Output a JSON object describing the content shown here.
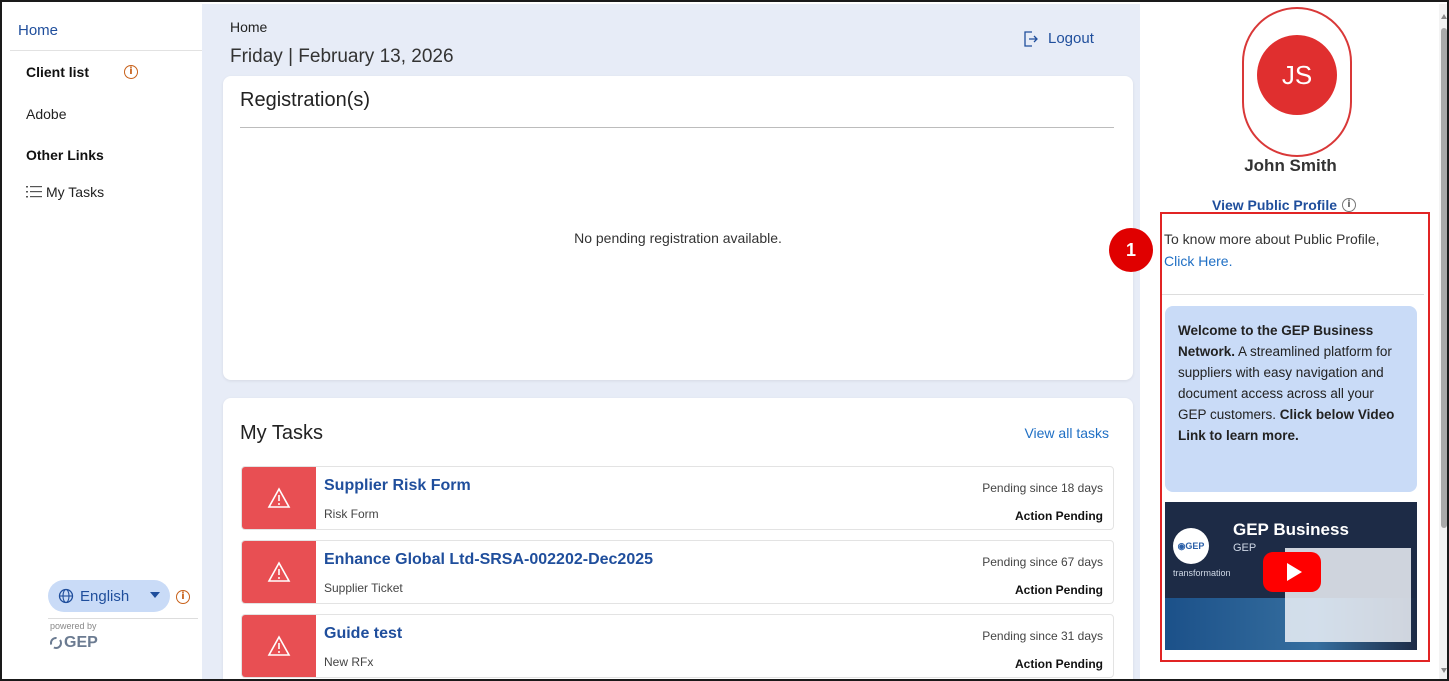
{
  "sidebar": {
    "home": "Home",
    "client_list": "Client list",
    "clients": [
      "Adobe"
    ],
    "other_links": "Other Links",
    "my_tasks": "My Tasks",
    "language": "English",
    "powered_by": "powered by",
    "brand": "GEP"
  },
  "header": {
    "breadcrumb": "Home",
    "date": "Friday | February 13, 2026",
    "logout": "Logout"
  },
  "registrations": {
    "title": "Registration(s)",
    "empty": "No pending registration available."
  },
  "tasks": {
    "title": "My Tasks",
    "view_all": "View all tasks",
    "items": [
      {
        "name": "Supplier Risk Form",
        "type": "Risk Form",
        "pending": "Pending since 18 days",
        "status": "Action Pending"
      },
      {
        "name": "Enhance Global Ltd-SRSA-002202-Dec2025",
        "type": "Supplier Ticket",
        "pending": "Pending since 67 days",
        "status": "Action Pending"
      },
      {
        "name": "Guide test",
        "type": "New RFx",
        "pending": "Pending since 31 days",
        "status": "Action Pending"
      }
    ]
  },
  "profile": {
    "initials": "JS",
    "name": "John Smith",
    "view_public": "View Public Profile",
    "know_more": "To know more about Public Profile,",
    "click_here": "Click Here.",
    "welcome_bold1": "Welcome to the GEP Business Network.",
    "welcome_text": " A streamlined platform for suppliers with easy navigation and document access across all your GEP customers. ",
    "welcome_bold2": "Click below Video Link to learn more.",
    "video_title": "GEP Business",
    "video_sub": "GEP",
    "video_caption": "transformation"
  },
  "annotation": {
    "number": "1",
    "color": "#e12424"
  },
  "colors": {
    "accent": "#1f4e9c",
    "task_alert": "#e84f53",
    "avatar": "#e02f2f",
    "panel_bg": "#e7ecf7"
  }
}
